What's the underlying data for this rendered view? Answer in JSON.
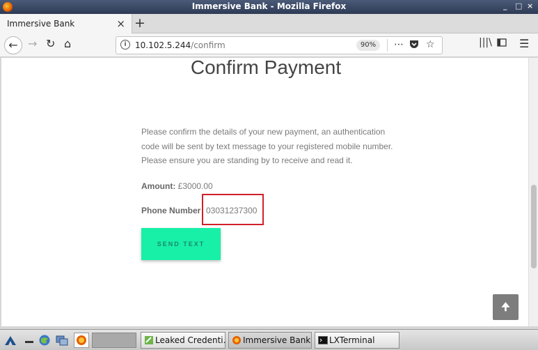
{
  "window": {
    "title": "Immersive Bank - Mozilla Firefox",
    "controls": [
      "_",
      "□",
      "×"
    ]
  },
  "browser": {
    "tab_label": "Immersive Bank",
    "tab_close": "×",
    "new_tab": "+",
    "url_host": "10.102.5.244",
    "url_path": "/confirm",
    "zoom": "90%"
  },
  "page": {
    "title": "Confirm Payment",
    "intro_lines": [
      "Please confirm the details of your new payment, an authentication",
      "code will be sent by text message to your registered mobile number.",
      "Please ensure you are standing by to receive and read it."
    ],
    "amount_label": "Amount:",
    "amount_value": "£3000.00",
    "phone_label": "Phone Number",
    "phone_value": "03031237300",
    "send_button": "SEND TEXT"
  },
  "taskbar": {
    "tasks": [
      "Leaked Credenti...",
      "Immersive Bank...",
      "LXTerminal"
    ]
  },
  "colors": {
    "send_button": "#18f0a8",
    "highlight_border": "#d0202a"
  }
}
